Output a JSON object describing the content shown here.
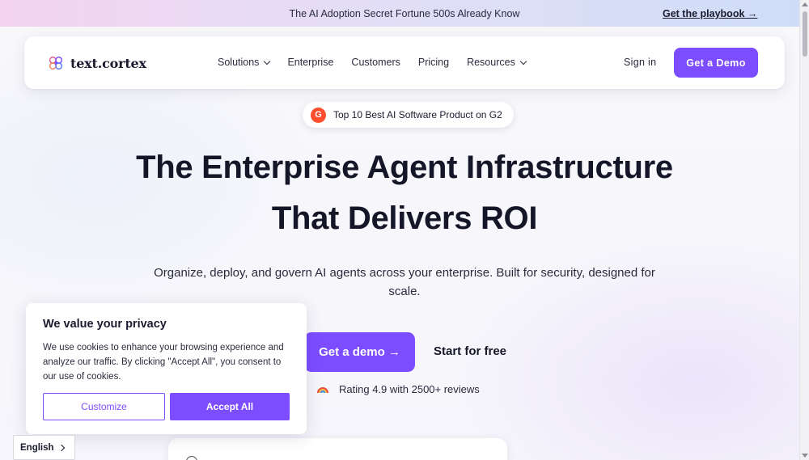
{
  "announcement": {
    "message": "The AI Adoption Secret Fortune 500s Already Know",
    "link_label": "Get the playbook →"
  },
  "nav": {
    "logo_text": "text.cortex",
    "items": [
      {
        "label": "Solutions",
        "has_dropdown": true
      },
      {
        "label": "Enterprise",
        "has_dropdown": false
      },
      {
        "label": "Customers",
        "has_dropdown": false
      },
      {
        "label": "Pricing",
        "has_dropdown": false
      },
      {
        "label": "Resources",
        "has_dropdown": true
      }
    ],
    "signin_label": "Sign in",
    "demo_label": "Get a Demo"
  },
  "badge": {
    "icon": "g2-logo-icon",
    "text": "Top 10 Best AI Software Product on G2"
  },
  "hero": {
    "title_line1": "The Enterprise Agent Infrastructure",
    "title_line2": "That Delivers ROI",
    "subtitle": "Organize, deploy, and govern AI agents across your enterprise. Built for security, designed for scale.",
    "cta_primary": "Get a demo →",
    "cta_secondary": "Start for free",
    "rating_text": "Rating 4.9 with 2500+ reviews"
  },
  "cookie": {
    "title": "We value your privacy",
    "body": "We use cookies to enhance your browsing experience and analyze our traffic. By clicking \"Accept All\", you consent to our use of cookies.",
    "customize_label": "Customize",
    "accept_label": "Accept All"
  },
  "language": {
    "selected": "English"
  },
  "colors": {
    "accent": "#7c4dff",
    "g2": "#ff4f2e",
    "text": "#1a1b2e"
  }
}
